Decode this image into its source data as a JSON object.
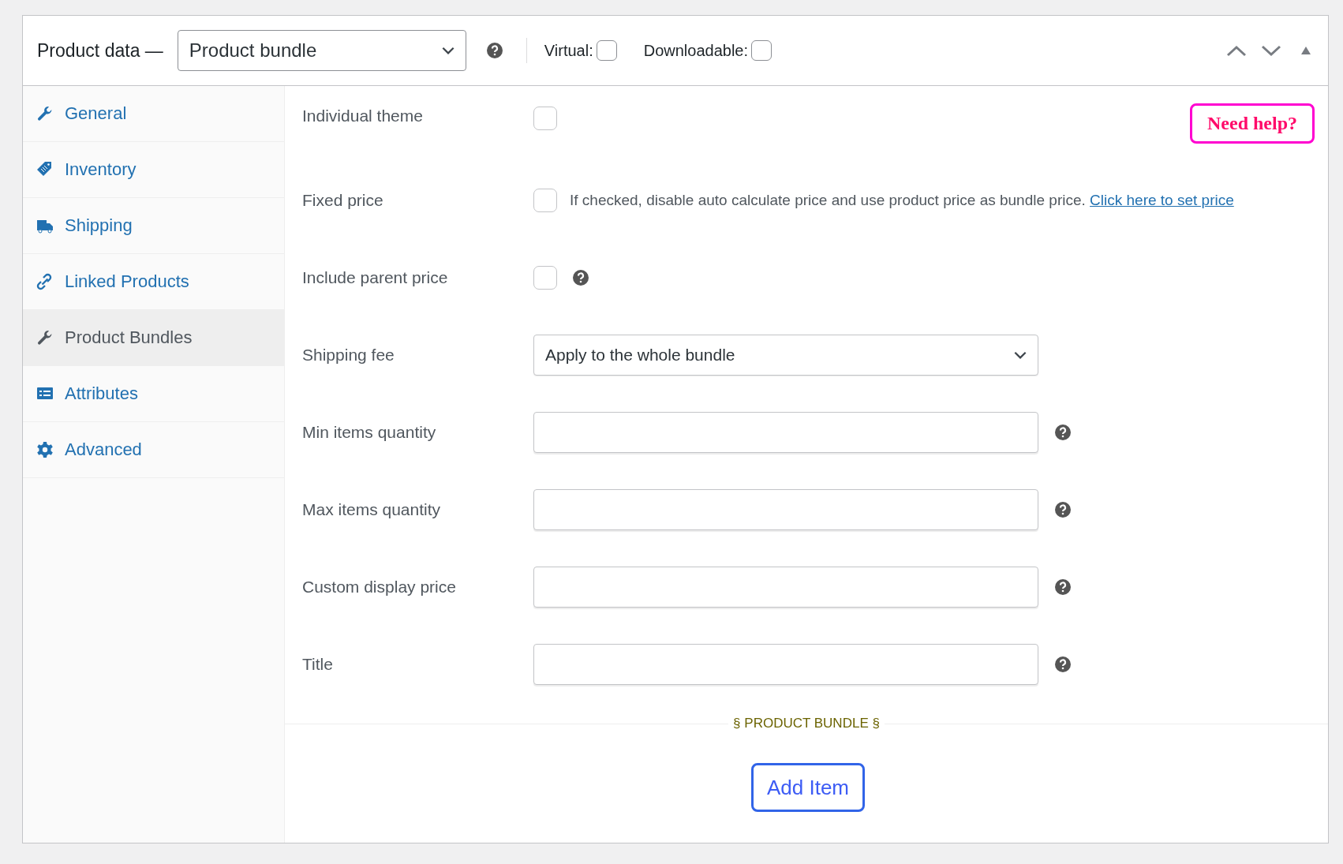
{
  "header": {
    "title": "Product data —",
    "product_type": {
      "value": "Product bundle"
    },
    "options": [
      {
        "label": "Virtual:",
        "checked": false
      },
      {
        "label": "Downloadable:",
        "checked": false
      }
    ]
  },
  "sidebar": {
    "items": [
      {
        "label": "General",
        "selected": false
      },
      {
        "label": "Inventory",
        "selected": false
      },
      {
        "label": "Shipping",
        "selected": false
      },
      {
        "label": "Linked Products",
        "selected": false
      },
      {
        "label": "Product Bundles",
        "selected": true
      },
      {
        "label": "Attributes",
        "selected": false
      },
      {
        "label": "Advanced",
        "selected": false
      }
    ]
  },
  "need_help_button": "Need help?",
  "fields": [
    {
      "kind": "checkbox",
      "label": "Individual theme",
      "checked": false,
      "help": false
    },
    {
      "kind": "checkbox",
      "label": "Fixed price",
      "checked": false,
      "help": false,
      "description": "If checked, disable auto calculate price and use product price as bundle price.",
      "link": "Click here to set price"
    },
    {
      "kind": "checkbox",
      "label": "Include parent price",
      "checked": false,
      "help": true
    },
    {
      "kind": "select",
      "label": "Shipping fee",
      "value": "Apply to the whole bundle",
      "help": false
    },
    {
      "kind": "text",
      "label": "Min items quantity",
      "help": true
    },
    {
      "kind": "text",
      "label": "Max items quantity",
      "help": true
    },
    {
      "kind": "text",
      "label": "Custom display price",
      "help": true
    },
    {
      "kind": "text",
      "label": "Title",
      "help": true
    }
  ],
  "section_title": "§ PRODUCT BUNDLE §",
  "add_item_button": "Add Item"
}
